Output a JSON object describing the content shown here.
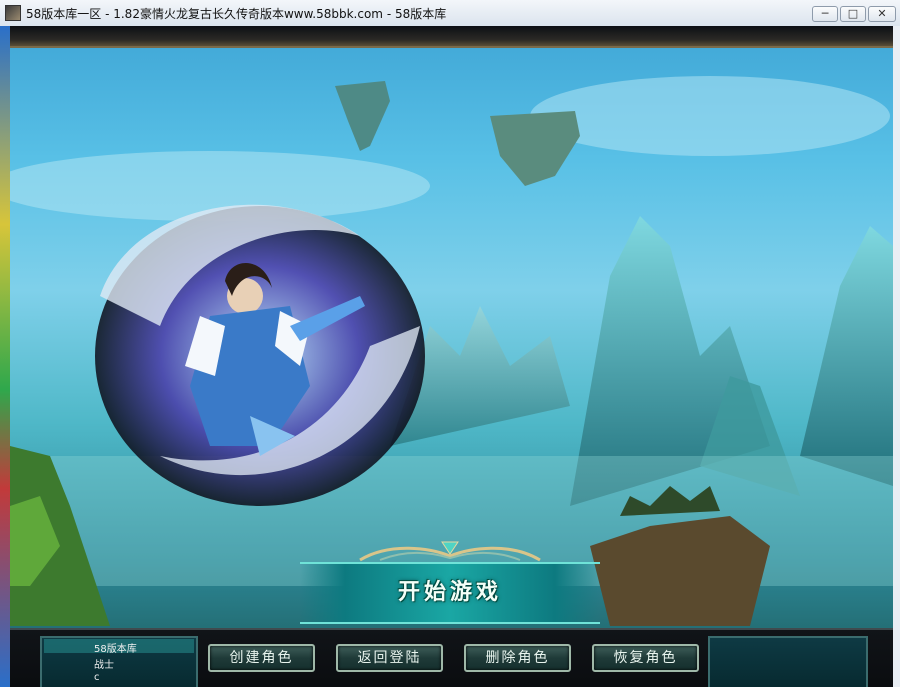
{
  "window": {
    "title": "58版本库一区 - 1.82豪情火龙复古长久传奇版本www.58bbk.com - 58版本库",
    "min_symbol": "─",
    "max_symbol": "□",
    "close_symbol": "✕"
  },
  "game": {
    "start_button_label": "开始游戏",
    "character_list": [
      "58版本库",
      "战士",
      "c"
    ],
    "buttons": {
      "create": "创建角色",
      "back": "返回登陆",
      "delete": "删除角色",
      "restore": "恢复角色"
    }
  },
  "colors": {
    "sky": "#58c0e6",
    "accent_teal": "#1aa7a4",
    "frame": "#0a0c0f"
  }
}
